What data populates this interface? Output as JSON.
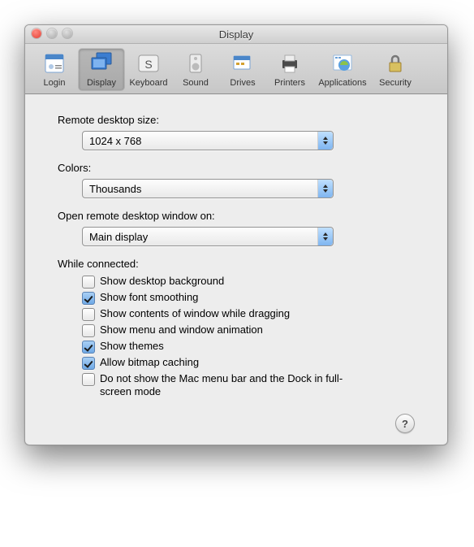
{
  "window": {
    "title": "Display"
  },
  "toolbar": {
    "items": [
      {
        "label": "Login"
      },
      {
        "label": "Display"
      },
      {
        "label": "Keyboard"
      },
      {
        "label": "Sound"
      },
      {
        "label": "Drives"
      },
      {
        "label": "Printers"
      },
      {
        "label": "Applications"
      },
      {
        "label": "Security"
      }
    ]
  },
  "labels": {
    "remote_size": "Remote desktop size:",
    "colors": "Colors:",
    "open_on": "Open remote desktop window on:",
    "while_connected": "While connected:"
  },
  "selects": {
    "remote_size_value": "1024 x 768",
    "colors_value": "Thousands",
    "open_on_value": "Main display"
  },
  "options": [
    {
      "label": "Show desktop background",
      "checked": false
    },
    {
      "label": "Show font smoothing",
      "checked": true
    },
    {
      "label": "Show contents of window while dragging",
      "checked": false
    },
    {
      "label": "Show menu and window animation",
      "checked": false
    },
    {
      "label": "Show themes",
      "checked": true
    },
    {
      "label": "Allow bitmap caching",
      "checked": true
    },
    {
      "label": "Do not show the Mac menu bar and the Dock in full-screen mode",
      "checked": false
    }
  ],
  "help": "?"
}
